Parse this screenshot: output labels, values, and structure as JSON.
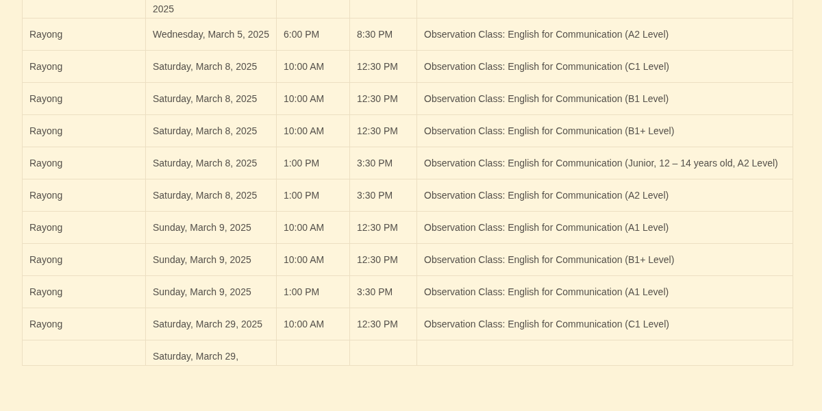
{
  "rows": [
    {
      "date": "2025"
    },
    {
      "location": "Rayong",
      "date": "Wednesday, March 5, 2025",
      "start": "6:00 PM",
      "end": "8:30 PM",
      "class": "Observation Class: English for Communication (A2 Level)"
    },
    {
      "location": "Rayong",
      "date": "Saturday, March 8, 2025",
      "start": "10:00 AM",
      "end": "12:30 PM",
      "class": "Observation Class: English for Communication (C1 Level)"
    },
    {
      "location": "Rayong",
      "date": "Saturday, March 8, 2025",
      "start": "10:00 AM",
      "end": "12:30 PM",
      "class": "Observation Class: English for Communication (B1 Level)"
    },
    {
      "location": "Rayong",
      "date": "Saturday, March 8, 2025",
      "start": "10:00 AM",
      "end": "12:30 PM",
      "class": "Observation Class: English for Communication (B1+ Level)"
    },
    {
      "location": "Rayong",
      "date": "Saturday, March 8, 2025",
      "start": "1:00 PM",
      "end": "3:30 PM",
      "class": "Observation Class: English for Communication (Junior, 12 – 14 years old, A2 Level)"
    },
    {
      "location": "Rayong",
      "date": "Saturday, March 8, 2025",
      "start": "1:00 PM",
      "end": "3:30 PM",
      "class": "Observation Class: English for Communication (A2 Level)"
    },
    {
      "location": "Rayong",
      "date": "Sunday, March 9, 2025",
      "start": "10:00 AM",
      "end": "12:30 PM",
      "class": "Observation Class: English for Communication (A1 Level)"
    },
    {
      "location": "Rayong",
      "date": "Sunday, March 9, 2025",
      "start": "10:00 AM",
      "end": "12:30 PM",
      "class": "Observation Class: English for Communication (B1+ Level)"
    },
    {
      "location": "Rayong",
      "date": "Sunday, March 9, 2025",
      "start": "1:00 PM",
      "end": "3:30 PM",
      "class": "Observation Class: English for Communication (A1 Level)"
    },
    {
      "location": "Rayong",
      "date": "Saturday, March 29, 2025",
      "start": "10:00 AM",
      "end": "12:30 PM",
      "class": "Observation Class: English for Communication (C1 Level)"
    },
    {
      "date": "Saturday, March 29,"
    }
  ]
}
